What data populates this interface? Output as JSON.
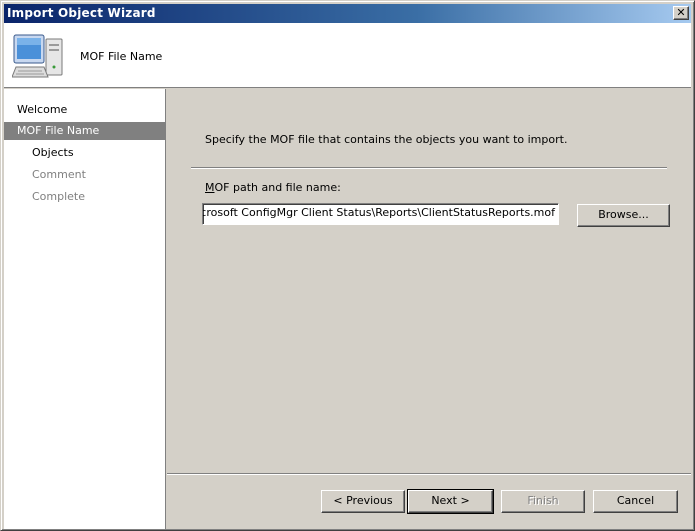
{
  "window": {
    "title": "Import Object Wizard",
    "close_glyph": "✕"
  },
  "header": {
    "title": "MOF File Name",
    "icon": "computer-icon"
  },
  "nav": {
    "items": [
      {
        "label": "Welcome",
        "state": "completed"
      },
      {
        "label": "MOF File Name",
        "state": "active"
      },
      {
        "label": "Objects",
        "state": "pending"
      },
      {
        "label": "Comment",
        "state": "disabled"
      },
      {
        "label": "Complete",
        "state": "disabled"
      }
    ]
  },
  "content": {
    "instruction": "Specify the MOF file that contains the objects you want to import.",
    "path_label_mnemonic": "M",
    "path_label_rest": "OF path and file name:",
    "path_value": "C:\\Program Files\\Microsoft ConfigMgr Client Status\\Reports\\ClientStatusReports.mof",
    "browse_label": "Browse..."
  },
  "footer": {
    "previous_label": "< Previous",
    "next_label": "Next >",
    "finish_label": "Finish",
    "cancel_label": "Cancel"
  },
  "colors": {
    "titlebar_start": "#0a246a",
    "titlebar_end": "#a6caf0",
    "face": "#d4d0c8",
    "active_nav": "#808080"
  }
}
